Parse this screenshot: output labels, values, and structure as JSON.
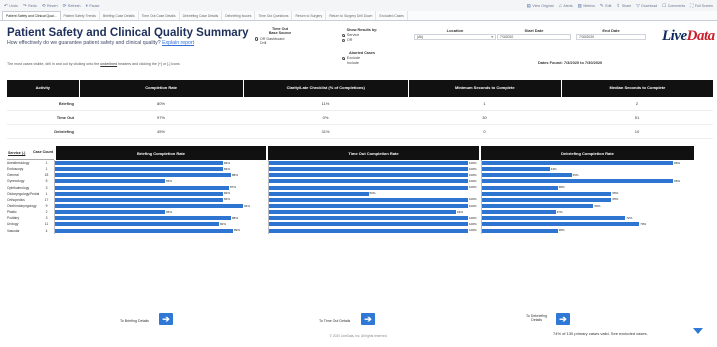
{
  "toolbar": {
    "left": [
      {
        "icon": "undo-icon",
        "label": "Undo"
      },
      {
        "icon": "redo-icon",
        "label": "Redo"
      },
      {
        "icon": "revert-icon",
        "label": "Revert"
      },
      {
        "icon": "refresh-icon",
        "label": "Refresh"
      },
      {
        "icon": "pause-icon",
        "label": "Pause"
      }
    ],
    "right": [
      {
        "icon": "view-original-icon",
        "label": "View Original"
      },
      {
        "icon": "alerts-icon",
        "label": "Alerts"
      },
      {
        "icon": "metrics-icon",
        "label": "Metrics"
      },
      {
        "icon": "edit-icon",
        "label": "Edit"
      },
      {
        "icon": "share-icon",
        "label": "Share"
      },
      {
        "icon": "download-icon",
        "label": "Download"
      },
      {
        "icon": "comments-icon",
        "label": "Comments"
      },
      {
        "icon": "full-screen-icon",
        "label": "Full Screen"
      }
    ]
  },
  "tabs": [
    {
      "label": "Patient Safety and Clinical Qual...",
      "active": true
    },
    {
      "label": "Patient Safety Trends",
      "active": false
    },
    {
      "label": "Briefing Case Details",
      "active": false
    },
    {
      "label": "Time Out Case Details",
      "active": false
    },
    {
      "label": "Debriefing Case Details",
      "active": false
    },
    {
      "label": "Debriefing Issues",
      "active": false
    },
    {
      "label": "Time Out Questions",
      "active": false
    },
    {
      "label": "Return to Surgery",
      "active": false
    },
    {
      "label": "Return to Surgery Drill Down",
      "active": false
    },
    {
      "label": "Excluded Cases",
      "active": false
    }
  ],
  "header": {
    "title": "Patient Safety and Clinical Quality Summary",
    "subtitle": "How effectively do we guarantee patient safety and clinical quality?",
    "subtitle_link": "Explain report"
  },
  "filters": {
    "time_out_base": {
      "label_line1": "Time Out",
      "label_line2": "Base Source",
      "options": [
        "OR Dashboard",
        "Drill"
      ],
      "selected": 0
    },
    "show_results": {
      "label": "Show Results by:",
      "options": [
        "Service",
        "OR"
      ],
      "selected": 0
    },
    "aborted_cases": {
      "label": "Aborted Cases",
      "options": [
        "Exclude",
        "Include"
      ],
      "selected": 0
    },
    "location": {
      "label": "Location",
      "value": "(All)"
    },
    "start_date": {
      "label": "Start Date",
      "value": "7/3/2020"
    },
    "end_date": {
      "label": "End Date",
      "value": "7/30/2020"
    }
  },
  "logo": {
    "part1": "Live",
    "part2": "Data"
  },
  "note": {
    "prefix": "The most cases visible, drill in and out by clicking onto the",
    "link": "underlined",
    "suffix": "headers and clicking the [+] or [-] icons"
  },
  "dates_found": "Dates Found: 7/3/2020 to 7/30/2020",
  "summary": {
    "headers": [
      "Activity",
      "Completion Rate",
      "Clarity/Late Checklist (% of Completions)",
      "Minimum Seconds to Complete",
      "Median Seconds to Complete"
    ],
    "rows": [
      {
        "activity": "Briefing",
        "rate": "80%",
        "clarity": "11%",
        "min": "1",
        "median": "2"
      },
      {
        "activity": "Time Out",
        "rate": "97%",
        "clarity": "0%",
        "min": "30",
        "median": "51"
      },
      {
        "activity": "Debriefing",
        "rate": "45%",
        "clarity": "31%",
        "min": "0",
        "median": "10"
      }
    ]
  },
  "detail": {
    "specialty_label": "Service (-)",
    "count_label": "Case Count",
    "charts": [
      "Briefing Completion Rate",
      "Time Out Completion Rate",
      "Debriefing Completion Rate"
    ],
    "rows": [
      {
        "name": "Anesthesiology",
        "count": "1",
        "briefing": 84,
        "timeout": 100,
        "debriefing": 96
      },
      {
        "name": "Endoscopy",
        "count": "1",
        "briefing": 84,
        "timeout": 100,
        "debriefing": 34
      },
      {
        "name": "General",
        "count": "18",
        "briefing": 88,
        "timeout": 100,
        "debriefing": 45
      },
      {
        "name": "Gynecology",
        "count": "5",
        "briefing": 55,
        "timeout": 100,
        "debriefing": 96
      },
      {
        "name": "Ophthalmology",
        "count": "3",
        "briefing": 87,
        "timeout": 100,
        "debriefing": 38
      },
      {
        "name": "Otolaryngology/Pediatric",
        "count": "1",
        "briefing": 84,
        "timeout": 50,
        "debriefing": 65
      },
      {
        "name": "Orthopedics",
        "count": "17",
        "briefing": 84,
        "timeout": 100,
        "debriefing": 65
      },
      {
        "name": "Otorhinolaryngology",
        "count": "9",
        "briefing": 94,
        "timeout": 100,
        "debriefing": 56
      },
      {
        "name": "Plastic",
        "count": "2",
        "briefing": 55,
        "timeout": 94,
        "debriefing": 37
      },
      {
        "name": "Podiatry",
        "count": "3",
        "briefing": 88,
        "timeout": 100,
        "debriefing": 72
      },
      {
        "name": "Urology",
        "count": "11",
        "briefing": 82,
        "timeout": 100,
        "debriefing": 79
      },
      {
        "name": "Vascular",
        "count": "4",
        "briefing": 89,
        "timeout": 100,
        "debriefing": 38
      }
    ]
  },
  "bottom": {
    "to_briefing": "To Briefing Details",
    "to_timeout": "To Time Out Details",
    "to_debriefing_l1": "To Debriefing",
    "to_debriefing_l2": "Details",
    "cases_note": "74% of 130 primary cases valid. See excluded cases.",
    "footer": "© 2020 LiveData, Inc. All rights reserved."
  },
  "colors": {
    "bar": "#2e74d1",
    "header_bg": "#111111",
    "title": "#1d2f5a",
    "link": "#2f6ed8"
  }
}
